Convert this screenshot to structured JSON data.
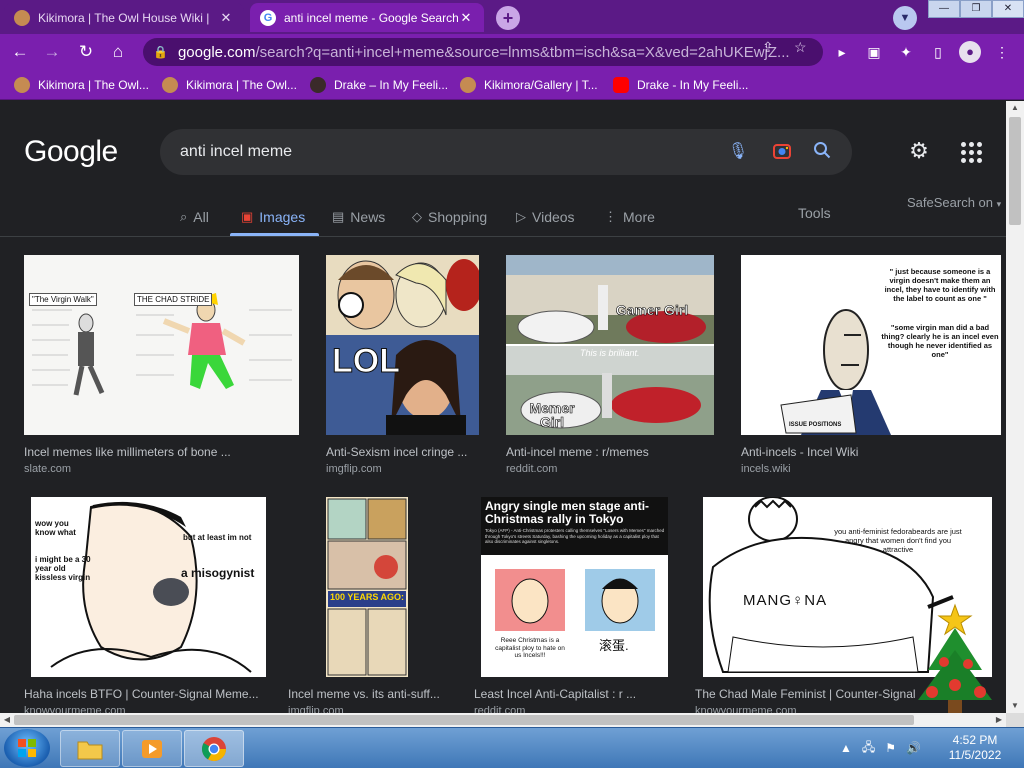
{
  "browser": {
    "tabs": [
      {
        "title": "Kikimora | The Owl House Wiki |",
        "close": "✕"
      },
      {
        "title": "anti incel meme - Google Search",
        "close": "✕"
      }
    ],
    "new_tab": "+",
    "window_buttons": [
      "—",
      "❐",
      "✕"
    ],
    "url_host": "google.com",
    "url_rest": "/search?q=anti+incel+meme&source=lnms&tbm=isch&sa=X&ved=2ahUKEwjZ...",
    "bookmarks": [
      {
        "label": "Kikimora | The Owl...",
        "icon_color": "#c58b52"
      },
      {
        "label": "Kikimora | The Owl...",
        "icon_color": "#c58b52"
      },
      {
        "label": "Drake – In My Feeli...",
        "icon_color": "#3a2a2a"
      },
      {
        "label": "Kikimora/Gallery | T...",
        "icon_color": "#c58b52"
      },
      {
        "label": "Drake - In My Feeli...",
        "icon_color": "#ff0000"
      }
    ]
  },
  "google": {
    "logo": "Google",
    "query": "anti incel meme",
    "tabs": [
      {
        "label": "All",
        "icon": "search-icon"
      },
      {
        "label": "Images",
        "icon": "image-icon"
      },
      {
        "label": "News",
        "icon": "news-icon"
      },
      {
        "label": "Shopping",
        "icon": "tag-icon"
      },
      {
        "label": "Videos",
        "icon": "play-icon"
      },
      {
        "label": "More",
        "icon": "more-vert-icon"
      }
    ],
    "tools": "Tools",
    "safesearch": "SafeSearch on"
  },
  "results": [
    {
      "title": "Incel memes like millimeters of bone ...",
      "source": "slate.com",
      "captions": [
        "\"The Virgin Walk\"",
        "THE CHAD STRIDE"
      ]
    },
    {
      "title": "Anti-Sexism incel cringe ...",
      "source": "imgflip.com",
      "captions": [
        "LOL"
      ]
    },
    {
      "title": "Anti-incel meme : r/memes",
      "source": "reddit.com",
      "captions": [
        "Gamer Girl",
        "This is brilliant.",
        "Memer Girl"
      ]
    },
    {
      "title": "Anti-incels - Incel Wiki",
      "source": "incels.wiki",
      "captions": [
        "\" just because someone is a virgin doesn't make them an incel, they have to identify with the label to count as one \"",
        "\"some virgin man did a bad thing? clearly he is an incel even though he never identified as one\"",
        "ISSUE POSITIONS"
      ]
    },
    {
      "title": "Haha incels BTFO | Counter-Signal Meme...",
      "source": "knowyourmeme.com",
      "captions": [
        "wow you know what",
        "but at least im not",
        "i might be a 30 year old kissless virgin",
        "a misogynist"
      ]
    },
    {
      "title": "Incel meme vs. its anti-suff...",
      "source": "imgflip.com",
      "captions": [
        "100 YEARS AGO:"
      ]
    },
    {
      "title": "Least Incel Anti-Capitalist : r ...",
      "source": "reddit.com",
      "captions": [
        "Angry single men stage anti-Christmas rally in Tokyo",
        "Tokyo (AFP) - Anti-Christmas protesters calling themselves \"Losers with Memes\" marched through Tokyo's streets Saturday, bashing the upcoming holiday as a capitalist ploy that also discriminates against singletons.",
        "Reee Christmas is a capitalist ploy to hate on us Incels!!!",
        "滚蛋."
      ]
    },
    {
      "title": "The Chad Male Feminist | Counter-Signal ...",
      "source": "knowyourmeme.com",
      "captions": [
        "you anti-feminist fedorabeards are just angry that women don't find you attractive",
        "MANG♀NA"
      ]
    }
  ],
  "taskbar": {
    "clock_time": "4:52 PM",
    "clock_date": "11/5/2022"
  },
  "colors": {
    "tabbar": "#5b1a86",
    "toolbar": "#7a1fae",
    "page_bg": "#202124",
    "link_blue": "#8ab4f8"
  }
}
